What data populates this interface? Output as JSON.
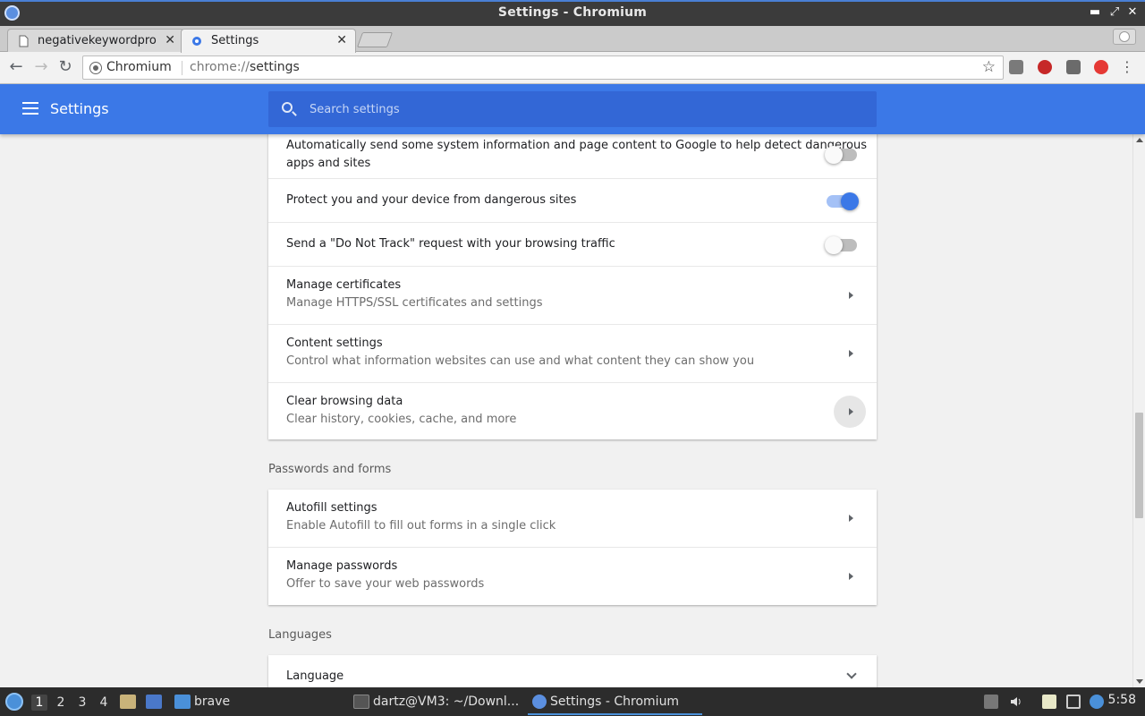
{
  "window": {
    "title": "Settings - Chromium",
    "minimize_glyph": "▬",
    "restore_glyph": "⤢",
    "close_glyph": "✕"
  },
  "tabs": [
    {
      "label": "negativekeywordpro",
      "icon": "page-icon",
      "active": false
    },
    {
      "label": "Settings",
      "icon": "gear-icon",
      "active": true
    }
  ],
  "tab_close_glyph": "✕",
  "toolbar": {
    "back_glyph": "←",
    "forward_glyph": "→",
    "reload_glyph": "↻",
    "site_chip": "Chromium",
    "url_scheme": "chrome://",
    "url_path": "settings",
    "star_glyph": "☆",
    "menu_glyph": "⋮",
    "extensions": [
      {
        "name": "extension-1-icon",
        "color": "#7a7a7a"
      },
      {
        "name": "extension-2-icon",
        "color": "#c62828"
      },
      {
        "name": "extension-3-icon",
        "color": "#6b6b6b"
      },
      {
        "name": "extension-4-icon",
        "color": "#e53935"
      }
    ]
  },
  "header": {
    "title": "Settings",
    "search_placeholder": "Search settings",
    "accent": "#3b78e7"
  },
  "privacy_card": {
    "rows": [
      {
        "primary": "Automatically send some system information and page content to Google to help detect dangerous",
        "primary2": "apps and sites",
        "toggle": false
      },
      {
        "primary": "Protect you and your device from dangerous sites",
        "toggle": true
      },
      {
        "primary": "Send a \"Do Not Track\" request with your browsing traffic",
        "toggle": false
      },
      {
        "primary": "Manage certificates",
        "secondary": "Manage HTTPS/SSL certificates and settings"
      },
      {
        "primary": "Content settings",
        "secondary": "Control what information websites can use and what content they can show you"
      },
      {
        "primary": "Clear browsing data",
        "secondary": "Clear history, cookies, cache, and more"
      }
    ]
  },
  "passwords_section": {
    "title": "Passwords and forms",
    "rows": [
      {
        "primary": "Autofill settings",
        "secondary": "Enable Autofill to fill out forms in a single click"
      },
      {
        "primary": "Manage passwords",
        "secondary": "Offer to save your web passwords"
      }
    ]
  },
  "languages_section": {
    "title": "Languages",
    "rows": [
      {
        "primary": "Language"
      }
    ]
  },
  "taskbar": {
    "workspaces": [
      "1",
      "2",
      "3",
      "4"
    ],
    "active_workspace": "1",
    "items": [
      {
        "label": "brave",
        "icon": "folder-icon"
      },
      {
        "label": "dartz@VM3: ~/Downl...",
        "icon": "terminal-icon"
      },
      {
        "label": "Settings - Chromium",
        "icon": "chromium-icon"
      }
    ],
    "clock": "5:58"
  }
}
